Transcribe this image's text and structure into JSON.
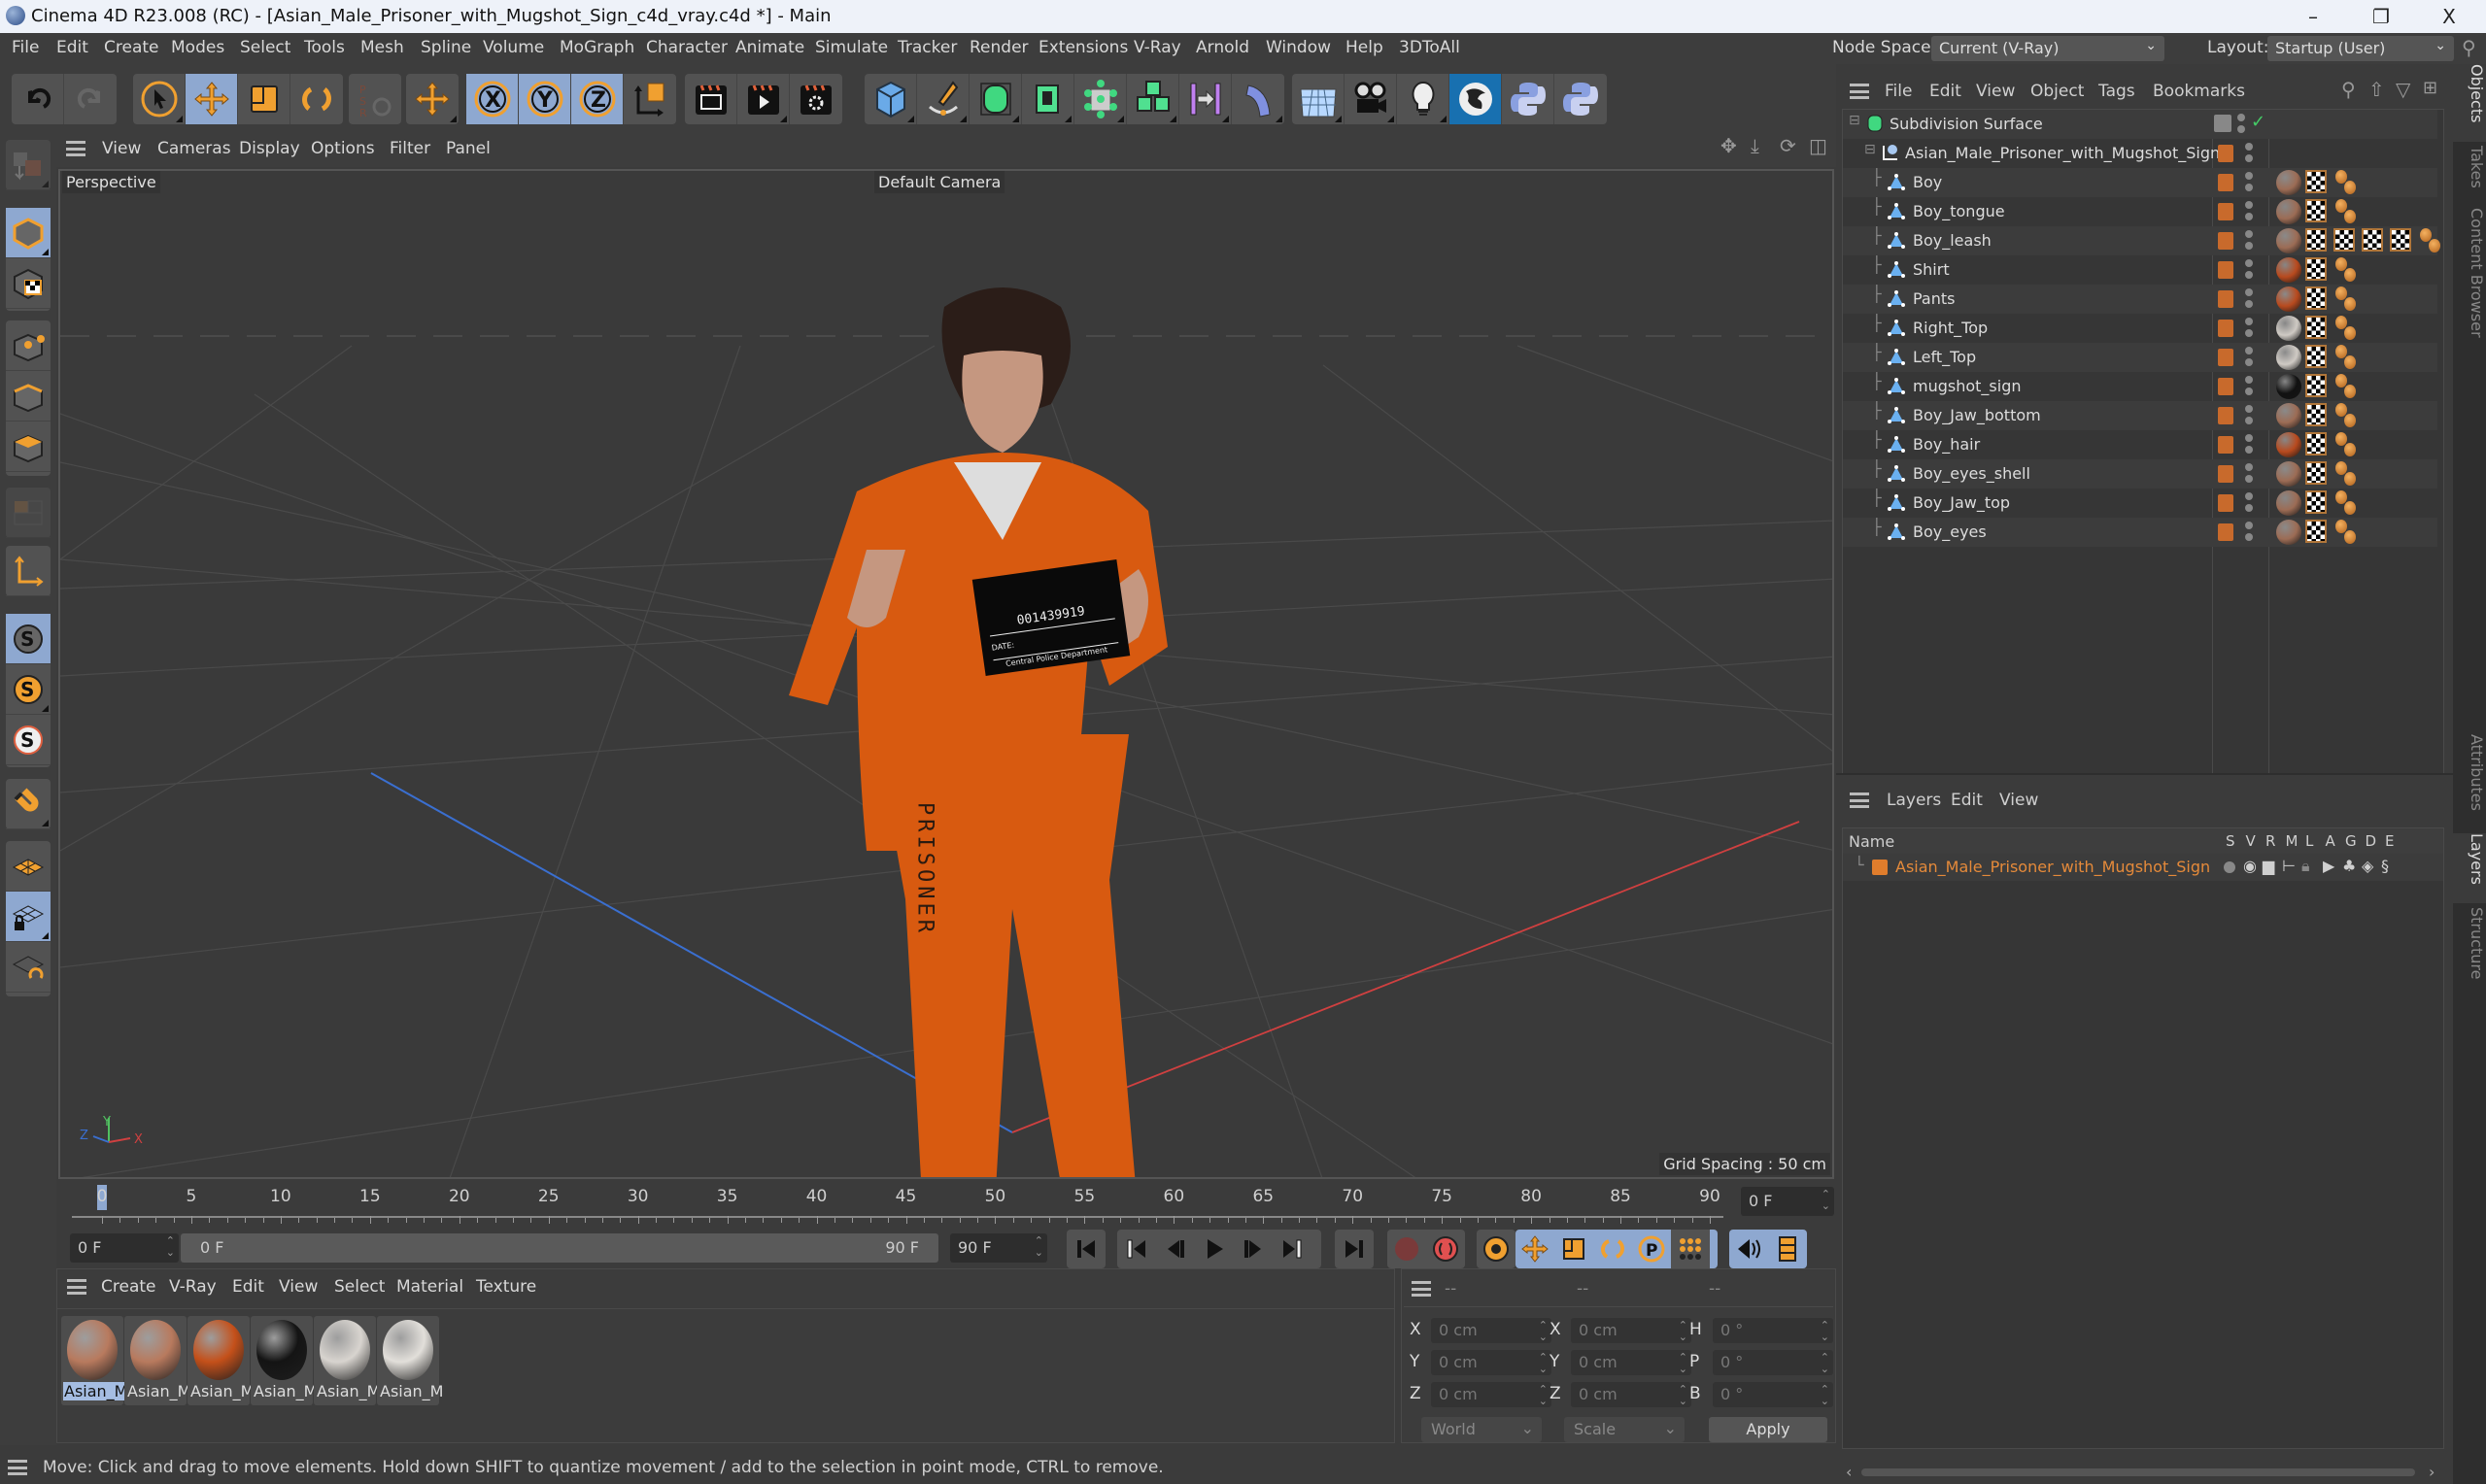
{
  "window": {
    "title": "Cinema 4D R23.008 (RC) - [Asian_Male_Prisoner_with_Mugshot_Sign_c4d_vray.c4d *] - Main",
    "minimize": "–",
    "restore": "❐",
    "close": "X"
  },
  "menubar": {
    "items": [
      "File",
      "Edit",
      "Create",
      "Modes",
      "Select",
      "Tools",
      "Mesh",
      "Spline",
      "Volume",
      "MoGraph",
      "Character",
      "Animate",
      "Simulate",
      "Tracker",
      "Render",
      "Extensions",
      "V-Ray",
      "Arnold",
      "Window",
      "Help",
      "3DToAll"
    ],
    "node_space_label": "Node Space:",
    "node_space_value": "Current (V-Ray)",
    "layout_label": "Layout:",
    "layout_value": "Startup (User)"
  },
  "toolbar": {
    "icons": [
      "undo-icon",
      "redo-icon",
      "live-selection-icon",
      "move-icon",
      "scale-icon",
      "rotate-icon",
      "psr-icon",
      "coordinate-system-icon",
      "x-axis-icon",
      "y-axis-icon",
      "z-axis-icon",
      "world-coordinates-icon",
      "render-view-icon",
      "render-to-picture-viewer-icon",
      "render-settings-icon",
      "cube-icon",
      "pen-icon",
      "subdivision-surface-icon",
      "extrude-icon",
      "cloner-icon",
      "mograph-icon",
      "symmetry-icon",
      "bend-deformer-icon",
      "floor-icon",
      "camera-icon",
      "light-icon",
      "vray-icon",
      "python-icon",
      "python-icon-2"
    ]
  },
  "viewport": {
    "menu": [
      "View",
      "Cameras",
      "Display",
      "Options",
      "Filter",
      "Panel"
    ],
    "view_label": "Perspective",
    "camera_label": "Default Camera",
    "grid_spacing": "Grid Spacing : 50 cm",
    "axis_labels": {
      "x": "X",
      "y": "Y",
      "z": "Z"
    },
    "mugshot": {
      "number": "001439919",
      "department": "Central Police Department",
      "date_label": "DATE:",
      "pants_text": "PRISONER"
    }
  },
  "timeline": {
    "ticks": [
      "0",
      "5",
      "10",
      "15",
      "20",
      "25",
      "30",
      "35",
      "40",
      "45",
      "50",
      "55",
      "60",
      "65",
      "70",
      "75",
      "80",
      "85",
      "90"
    ],
    "current_frame_field": "0 F",
    "start_frame": "0 F",
    "range_start": "0 F",
    "range_end": "90 F",
    "end_frame": "90 F",
    "min_frame": 0,
    "max_frame": 90,
    "current_frame": 0
  },
  "materials": {
    "menu": [
      "Create",
      "V-Ray",
      "Edit",
      "View",
      "Select",
      "Material",
      "Texture"
    ],
    "items": [
      {
        "label": "Asian_M",
        "selected": true,
        "color": "#b87a5e"
      },
      {
        "label": "Asian_M",
        "selected": false,
        "color": "#b87a5e"
      },
      {
        "label": "Asian_M",
        "selected": false,
        "color": "#c4501a"
      },
      {
        "label": "Asian_M",
        "selected": false,
        "color": "#141414"
      },
      {
        "label": "Asian_M",
        "selected": false,
        "color": "#d8d4cf"
      },
      {
        "label": "Asian_M",
        "selected": false,
        "color": "#e2dfda"
      }
    ]
  },
  "coordinates": {
    "headers": [
      "--",
      "--",
      "--"
    ],
    "rows": [
      {
        "l1": "X",
        "v1": "0 cm",
        "l2": "X",
        "v2": "0 cm",
        "l3": "H",
        "v3": "0 °"
      },
      {
        "l1": "Y",
        "v1": "0 cm",
        "l2": "Y",
        "v2": "0 cm",
        "l3": "P",
        "v3": "0 °"
      },
      {
        "l1": "Z",
        "v1": "0 cm",
        "l2": "Z",
        "v2": "0 cm",
        "l3": "B",
        "v3": "0 °"
      }
    ],
    "mode": "World",
    "transform": "Scale",
    "apply": "Apply"
  },
  "status": "Move: Click and drag to move elements. Hold down SHIFT to quantize movement / add to the selection in point mode, CTRL to remove.",
  "objects": {
    "menu": [
      "File",
      "Edit",
      "View",
      "Object",
      "Tags",
      "Bookmarks"
    ],
    "root": "Subdivision Surface",
    "group": "Asian_Male_Prisoner_with_Mugshot_Sign",
    "children": [
      {
        "name": "Boy",
        "mat": "#9c6c55",
        "extra_tex": 0
      },
      {
        "name": "Boy_tongue",
        "mat": "#9c6c55",
        "extra_tex": 0
      },
      {
        "name": "Boy_leash",
        "mat": "#9c6c55",
        "extra_tex": 3
      },
      {
        "name": "Shirt",
        "mat": "#b84a1e",
        "extra_tex": 0
      },
      {
        "name": "Pants",
        "mat": "#b84a1e",
        "extra_tex": 0
      },
      {
        "name": "Right_Top",
        "mat": "#cfcac4",
        "extra_tex": 0
      },
      {
        "name": "Left_Top",
        "mat": "#cfcac4",
        "extra_tex": 0
      },
      {
        "name": "mugshot_sign",
        "mat": "#111111",
        "extra_tex": 0
      },
      {
        "name": "Boy_Jaw_bottom",
        "mat": "#9c6c55",
        "extra_tex": 0
      },
      {
        "name": "Boy_hair",
        "mat": "#b84a1e",
        "extra_tex": 0
      },
      {
        "name": "Boy_eyes_shell",
        "mat": "#9c6c55",
        "extra_tex": 0
      },
      {
        "name": "Boy_Jaw_top",
        "mat": "#9c6c55",
        "extra_tex": 0
      },
      {
        "name": "Boy_eyes",
        "mat": "#9c6c55",
        "extra_tex": 0
      }
    ]
  },
  "layers": {
    "menu": [
      "Layers",
      "Edit",
      "View"
    ],
    "name_header": "Name",
    "columns": [
      "S",
      "V",
      "R",
      "M",
      "L",
      "A",
      "G",
      "D",
      "E"
    ],
    "items": [
      {
        "name": "Asian_Male_Prisoner_with_Mugshot_Sign",
        "color": "#e07d2c"
      }
    ]
  },
  "side_tabs": {
    "top": [
      "Objects",
      "Takes",
      "Content Browser"
    ],
    "bottom": [
      "Attributes",
      "Layers",
      "Structure"
    ]
  },
  "colors": {
    "accent_orange": "#f0a030",
    "selection_blue": "#8ea8d0",
    "layer_text": "#e58a3a"
  }
}
